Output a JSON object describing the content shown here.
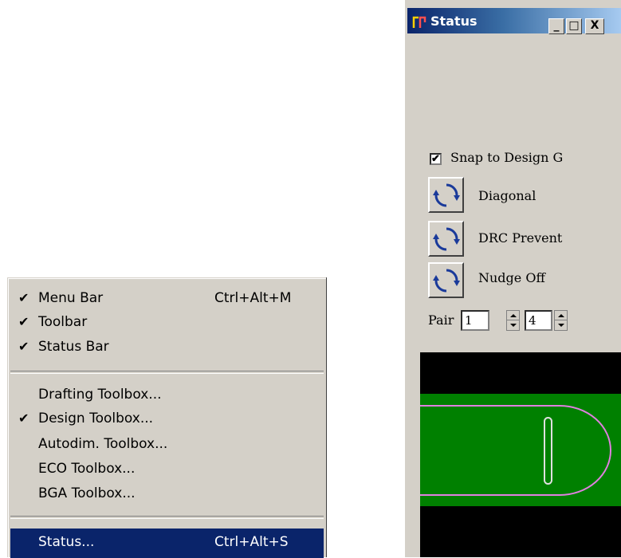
{
  "menu": {
    "items": [
      {
        "checked": true,
        "label": "Menu Bar",
        "shortcut": "Ctrl+Alt+M"
      },
      {
        "checked": true,
        "label": "Toolbar",
        "shortcut": ""
      },
      {
        "checked": true,
        "label": "Status Bar",
        "shortcut": ""
      },
      {
        "checked": false,
        "label": "Drafting Toolbox...",
        "shortcut": ""
      },
      {
        "checked": true,
        "label": "Design Toolbox...",
        "shortcut": ""
      },
      {
        "checked": false,
        "label": "Autodim. Toolbox...",
        "shortcut": ""
      },
      {
        "checked": false,
        "label": "ECO Toolbox...",
        "shortcut": ""
      },
      {
        "checked": false,
        "label": "BGA Toolbox...",
        "shortcut": ""
      },
      {
        "checked": false,
        "label": "Status...",
        "shortcut": "Ctrl+Alt+S"
      }
    ],
    "check_glyph": "✔",
    "highlight_color": "#0a246a"
  },
  "status_window": {
    "title": "Status",
    "title_icon": "app-icon",
    "buttons": {
      "minimize": "_",
      "maximize": "□",
      "close": "X"
    },
    "snap": {
      "checked": true,
      "check_glyph": "✔",
      "label": "Snap to Design G"
    },
    "toggles": [
      {
        "label": "Diagonal",
        "icon": "cycle-arrows-icon"
      },
      {
        "label": "DRC Prevent",
        "icon": "cycle-arrows-icon"
      },
      {
        "label": "Nudge Off",
        "icon": "cycle-arrows-icon"
      }
    ],
    "pair": {
      "label": "Pair",
      "value_a": "1",
      "value_b": "4"
    },
    "preview": {
      "board_color": "#008000",
      "background_color": "#000000",
      "outline_color": "#e080e0"
    }
  }
}
